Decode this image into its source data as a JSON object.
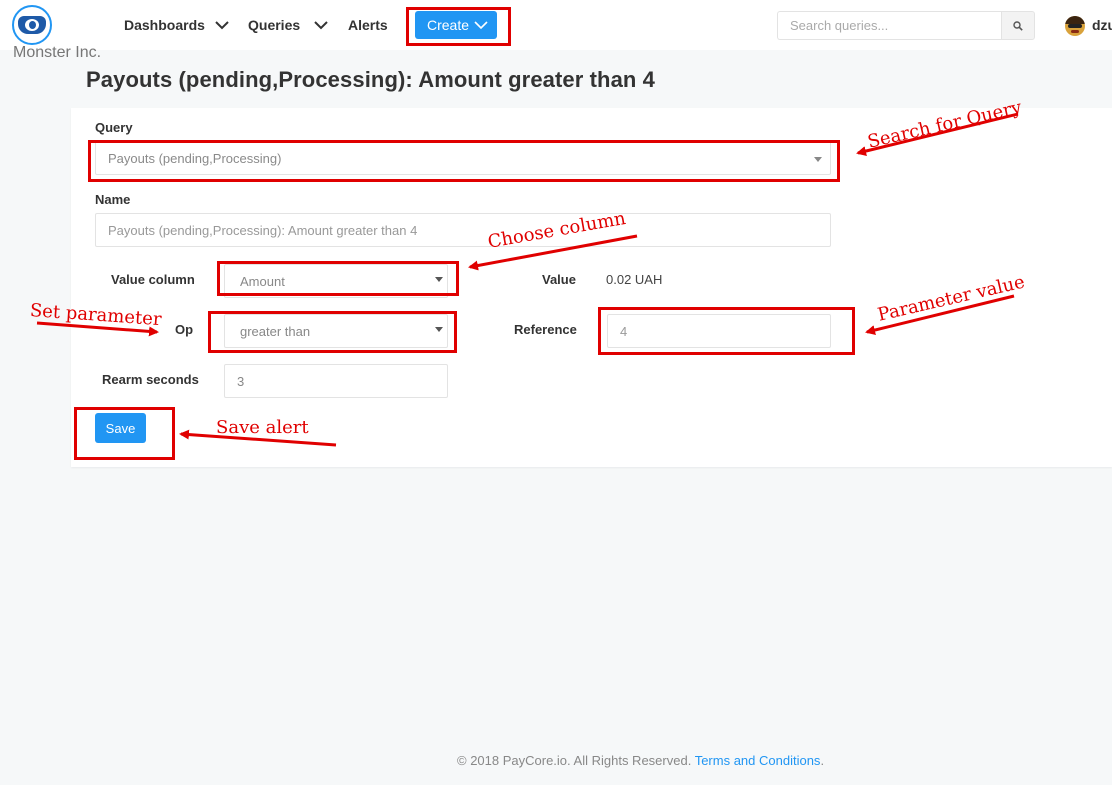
{
  "header": {
    "org_name": "Monster Inc.",
    "nav": [
      {
        "label": "Dashboards",
        "has_dropdown": true
      },
      {
        "label": "Queries",
        "has_dropdown": true
      },
      {
        "label": "Alerts",
        "has_dropdown": false
      }
    ],
    "create_label": "Create",
    "search_placeholder": "Search queries...",
    "username": "dzu"
  },
  "page": {
    "title": "Payouts (pending,Processing): Amount greater than 4"
  },
  "form": {
    "query_label": "Query",
    "query_value": "Payouts (pending,Processing)",
    "name_label": "Name",
    "name_placeholder": "Payouts (pending,Processing): Amount greater than 4",
    "value_column_label": "Value column",
    "value_column_selected": "Amount",
    "value_label": "Value",
    "value_text": "0.02 UAH",
    "op_label": "Op",
    "op_selected": "greater than",
    "reference_label": "Reference",
    "reference_value": "4",
    "rearm_label": "Rearm seconds",
    "rearm_value": "3",
    "save_label": "Save"
  },
  "annotations": {
    "search_for_query": "Search for Query",
    "choose_column": "Choose column",
    "set_parameter": "Set parameter",
    "parameter_value": "Parameter value",
    "save_alert": "Save alert",
    "color": "#e00000"
  },
  "footer": {
    "copyright": "© 2018 PayCore.io. All Rights Reserved.",
    "link_text": "Terms and Conditions",
    "suffix": "."
  },
  "colors": {
    "accent": "#2196f3",
    "background": "#f6f8f9",
    "annotation_red": "#e00000"
  },
  "icons": {
    "logo": "monster-eye-logo",
    "search": "search-icon",
    "chevron": "chevron-down-icon",
    "avatar": "user-avatar"
  }
}
